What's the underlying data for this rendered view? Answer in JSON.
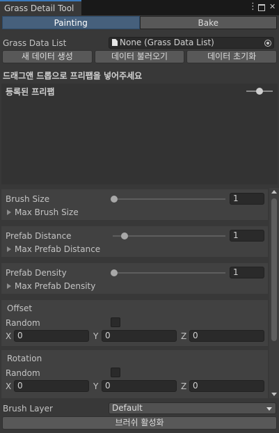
{
  "window": {
    "title": "Grass Detail Tool"
  },
  "toolbar": {
    "painting_label": "Painting",
    "bake_label": "Bake"
  },
  "data_list": {
    "label": "Grass Data List",
    "value": "None (Grass Data List)",
    "buttons": [
      "새 데이터 생성",
      "데이터 불러오기",
      "데이터 초기화"
    ]
  },
  "prefab": {
    "instruction": "드래그앤 드롭으로 프리팹을 넣어주세요",
    "registered_label": "등록된 프리팹",
    "size_slider_value": 0.5
  },
  "brush": {
    "size_label": "Brush Size",
    "size_value": "1",
    "size_slider": 0.0,
    "max_size_label": "Max Brush Size",
    "distance_label": "Prefab Distance",
    "distance_value": "1",
    "distance_slider": 0.1,
    "max_distance_label": "Max Prefab Distance",
    "density_label": "Prefab Density",
    "density_value": "1",
    "density_slider": 0.0,
    "max_density_label": "Max Prefab Density"
  },
  "offset": {
    "title": "Offset",
    "random_label": "Random",
    "random_checked": false,
    "x_label": "X",
    "x_value": "0",
    "y_label": "Y",
    "y_value": "0",
    "z_label": "Z",
    "z_value": "0"
  },
  "rotation": {
    "title": "Rotation",
    "random_label": "Random",
    "random_checked": false,
    "x_label": "X",
    "x_value": "0",
    "y_label": "Y",
    "y_value": "0",
    "z_label": "Z",
    "z_value": "0"
  },
  "footer": {
    "layer_label": "Brush Layer",
    "layer_value": "Default",
    "activate_label": "브러쉬 활성화"
  }
}
